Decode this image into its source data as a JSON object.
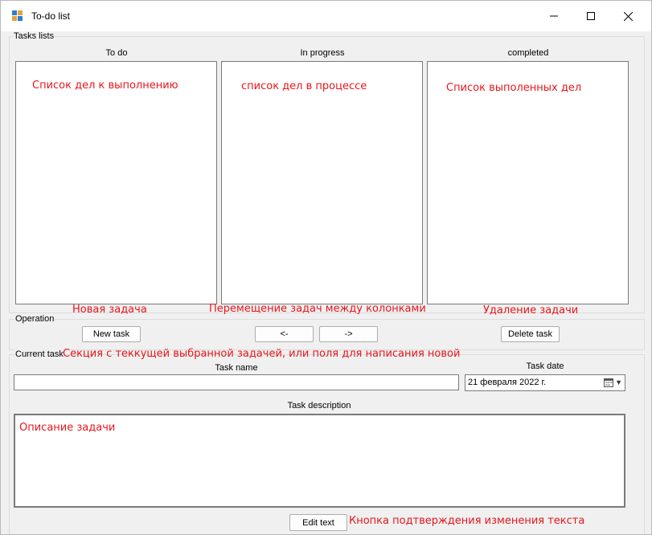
{
  "window": {
    "title": "To-do list",
    "controls": {
      "minimize": "—",
      "maximize": "☐",
      "close": "✕"
    }
  },
  "tasks_lists": {
    "group_label": "Tasks lists",
    "columns": [
      {
        "label": "To do",
        "note": "Список дел к выполнению"
      },
      {
        "label": "In progress",
        "note": "список дел в процессе"
      },
      {
        "label": "completed",
        "note": "Список выполенных дел"
      }
    ]
  },
  "annotations": {
    "new_task": "Новая задача",
    "move_tasks": "Перемещение задач между колонками",
    "delete_task": "Удаление задачи",
    "current_task": "Секция с теккущей выбранной задачей, или поля для написания новой",
    "description": "Описание задачи",
    "edit_text": "Кнопка подтверждения изменения текста"
  },
  "operation": {
    "group_label": "Operation",
    "new_task_label": "New task",
    "move_left_label": "<-",
    "move_right_label": "->",
    "delete_task_label": "Delete task"
  },
  "current_task": {
    "group_label": "Current task",
    "task_name_label": "Task name",
    "task_name_value": "",
    "task_date_label": "Task date",
    "task_date_value": "21 февраля  2022 г.",
    "task_description_label": "Task description",
    "edit_text_label": "Edit text"
  },
  "colors": {
    "annotation": "#e8161c",
    "window_bg": "#f0f0f0"
  }
}
